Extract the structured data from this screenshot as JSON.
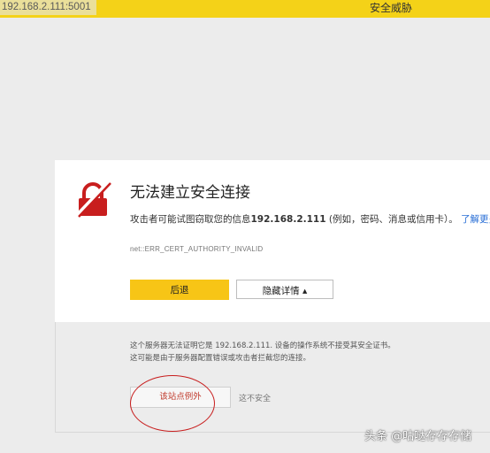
{
  "topbar": {
    "url": "192.168.2.111:5001",
    "threat_label": "安全威胁"
  },
  "error": {
    "title": "无法建立安全连接",
    "desc_prefix": "攻击者可能试图窃取您的信息",
    "host": "192.168.2.111",
    "desc_suffix": " (例如，密码、消息或信用卡）。",
    "learn_more": "了解更多",
    "code": "net::ERR_CERT_AUTHORITY_INVALID"
  },
  "buttons": {
    "back": "后退",
    "details": "隐藏详情 ▴"
  },
  "details": {
    "note": "这个服务器无法证明它是 192.168.2.111. 设备的操作系统不接受其安全证书。这可能是由于服务器配置错误或攻击者拦截您的连接。",
    "proceed": "该站点例外",
    "unsafe": "这不安全"
  },
  "watermark": "头条 @咕哒存存存储",
  "colors": {
    "topbar": "#f4d218",
    "primary_button": "#f7c516",
    "annotation": "#c81e1e",
    "lock": "#c81e1e"
  }
}
